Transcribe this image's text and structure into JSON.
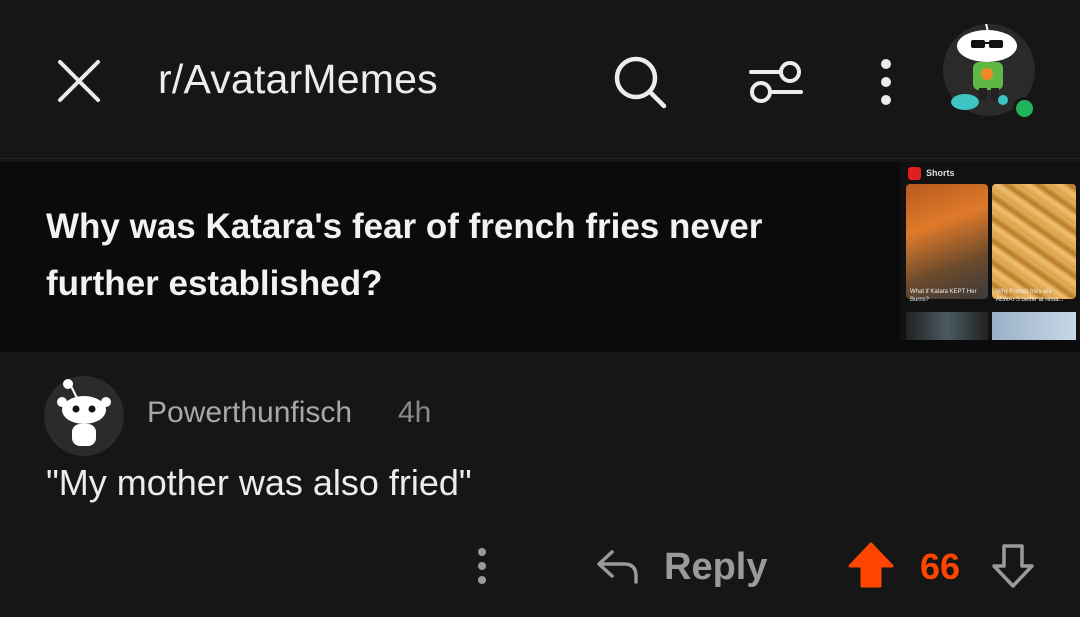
{
  "header": {
    "title": "r/AvatarMemes",
    "icons": [
      "close-icon",
      "search-icon",
      "filter-icon",
      "more-vertical-icon",
      "avatar"
    ]
  },
  "post": {
    "title": "Why was Katara's fear of french fries never further established?",
    "thumbnail": {
      "label": "Shorts",
      "captions": [
        "What if Katara KEPT Her Burns?",
        "Why French fries are ALWAYS better at resta..."
      ]
    }
  },
  "comment": {
    "username": "Powerthunfisch",
    "time": "4h",
    "text": "\"My mother was also fried\"",
    "actions": {
      "reply_label": "Reply",
      "score": "66"
    }
  },
  "colors": {
    "background": "#161616",
    "accent": "#ff4500",
    "online": "#21b35a"
  }
}
